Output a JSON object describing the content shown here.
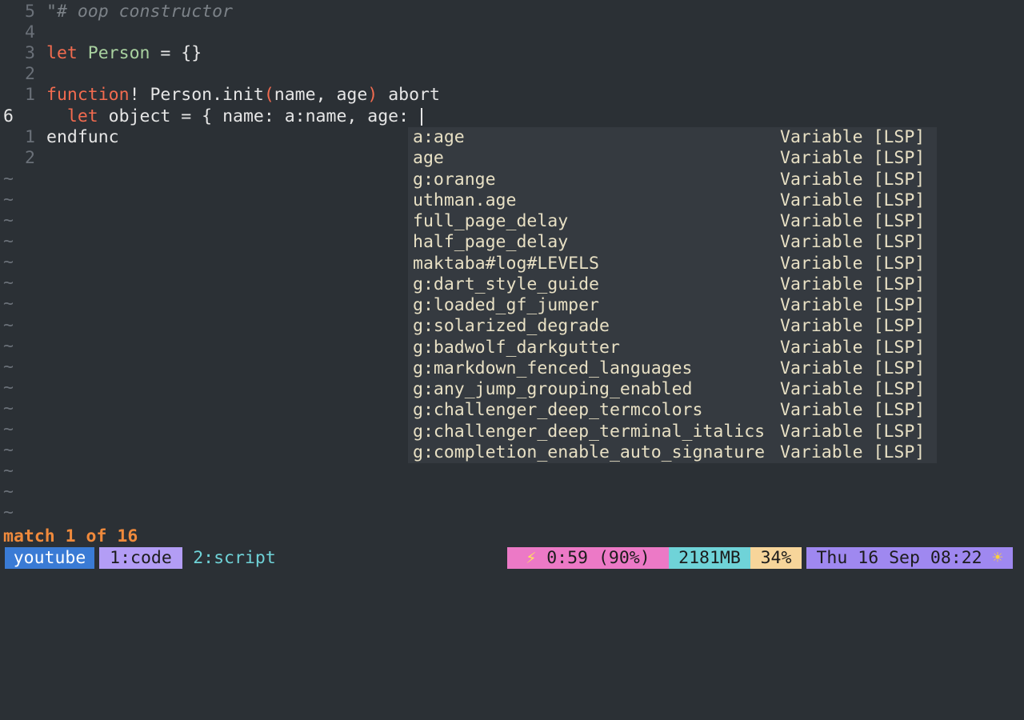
{
  "editor": {
    "lines": [
      {
        "num": "5",
        "segments": [
          {
            "t": "\"# oop constructor",
            "c": "comment"
          }
        ]
      },
      {
        "num": "4",
        "segments": []
      },
      {
        "num": "3",
        "segments": [
          {
            "t": "let",
            "c": "kw"
          },
          {
            "t": " ",
            "c": "plain"
          },
          {
            "t": "Person",
            "c": "type"
          },
          {
            "t": " = {}",
            "c": "plain"
          }
        ]
      },
      {
        "num": "2",
        "segments": []
      },
      {
        "num": "1",
        "segments": [
          {
            "t": "function",
            "c": "kw"
          },
          {
            "t": "! Person.init",
            "c": "plain"
          },
          {
            "t": "(",
            "c": "paren"
          },
          {
            "t": "name, age",
            "c": "plain"
          },
          {
            "t": ")",
            "c": "paren"
          },
          {
            "t": " abort",
            "c": "plain"
          }
        ]
      },
      {
        "num": "6",
        "current": true,
        "segments": [
          {
            "t": "  let",
            "c": "kw"
          },
          {
            "t": " object = { name: a:name, age: ",
            "c": "plain"
          }
        ]
      },
      {
        "num": "1",
        "segments": [
          {
            "t": "endfunc",
            "c": "plain"
          }
        ]
      },
      {
        "num": "2",
        "segments": []
      }
    ],
    "tilde": "~",
    "tilde_count": 17
  },
  "completion_menu": {
    "items": [
      {
        "word": "a:age",
        "kind": "Variable [LSP]"
      },
      {
        "word": "age",
        "kind": "Variable [LSP]"
      },
      {
        "word": "g:orange",
        "kind": "Variable [LSP]"
      },
      {
        "word": "uthman.age",
        "kind": "Variable [LSP]"
      },
      {
        "word": "full_page_delay",
        "kind": "Variable [LSP]"
      },
      {
        "word": "half_page_delay",
        "kind": "Variable [LSP]"
      },
      {
        "word": "maktaba#log#LEVELS",
        "kind": "Variable [LSP]"
      },
      {
        "word": "g:dart_style_guide",
        "kind": "Variable [LSP]"
      },
      {
        "word": "g:loaded_gf_jumper",
        "kind": "Variable [LSP]"
      },
      {
        "word": "g:solarized_degrade",
        "kind": "Variable [LSP]"
      },
      {
        "word": "g:badwolf_darkgutter",
        "kind": "Variable [LSP]"
      },
      {
        "word": "g:markdown_fenced_languages",
        "kind": "Variable [LSP]"
      },
      {
        "word": "g:any_jump_grouping_enabled",
        "kind": "Variable [LSP]"
      },
      {
        "word": "g:challenger_deep_termcolors",
        "kind": "Variable [LSP]"
      },
      {
        "word": "g:challenger_deep_terminal_italics",
        "kind": "Variable [LSP]"
      },
      {
        "word": "g:completion_enable_auto_signature",
        "kind": "Variable [LSP]"
      }
    ]
  },
  "message": "match 1 of 16",
  "statusbar": {
    "session": "youtube",
    "window1": "1:code",
    "window2": "2:script",
    "battery_icon": "⚡",
    "battery": "0:59 (90%)",
    "memory": "2181MB",
    "cpu": "34%",
    "datetime": "Thu 16 Sep 08:22",
    "weather_icon": "☀"
  },
  "colors": {
    "background": "#2b3035",
    "keyword": "#f26b4f",
    "type": "#a9d2a0",
    "message": "#f08a3c",
    "popup_bg": "#353a40"
  }
}
